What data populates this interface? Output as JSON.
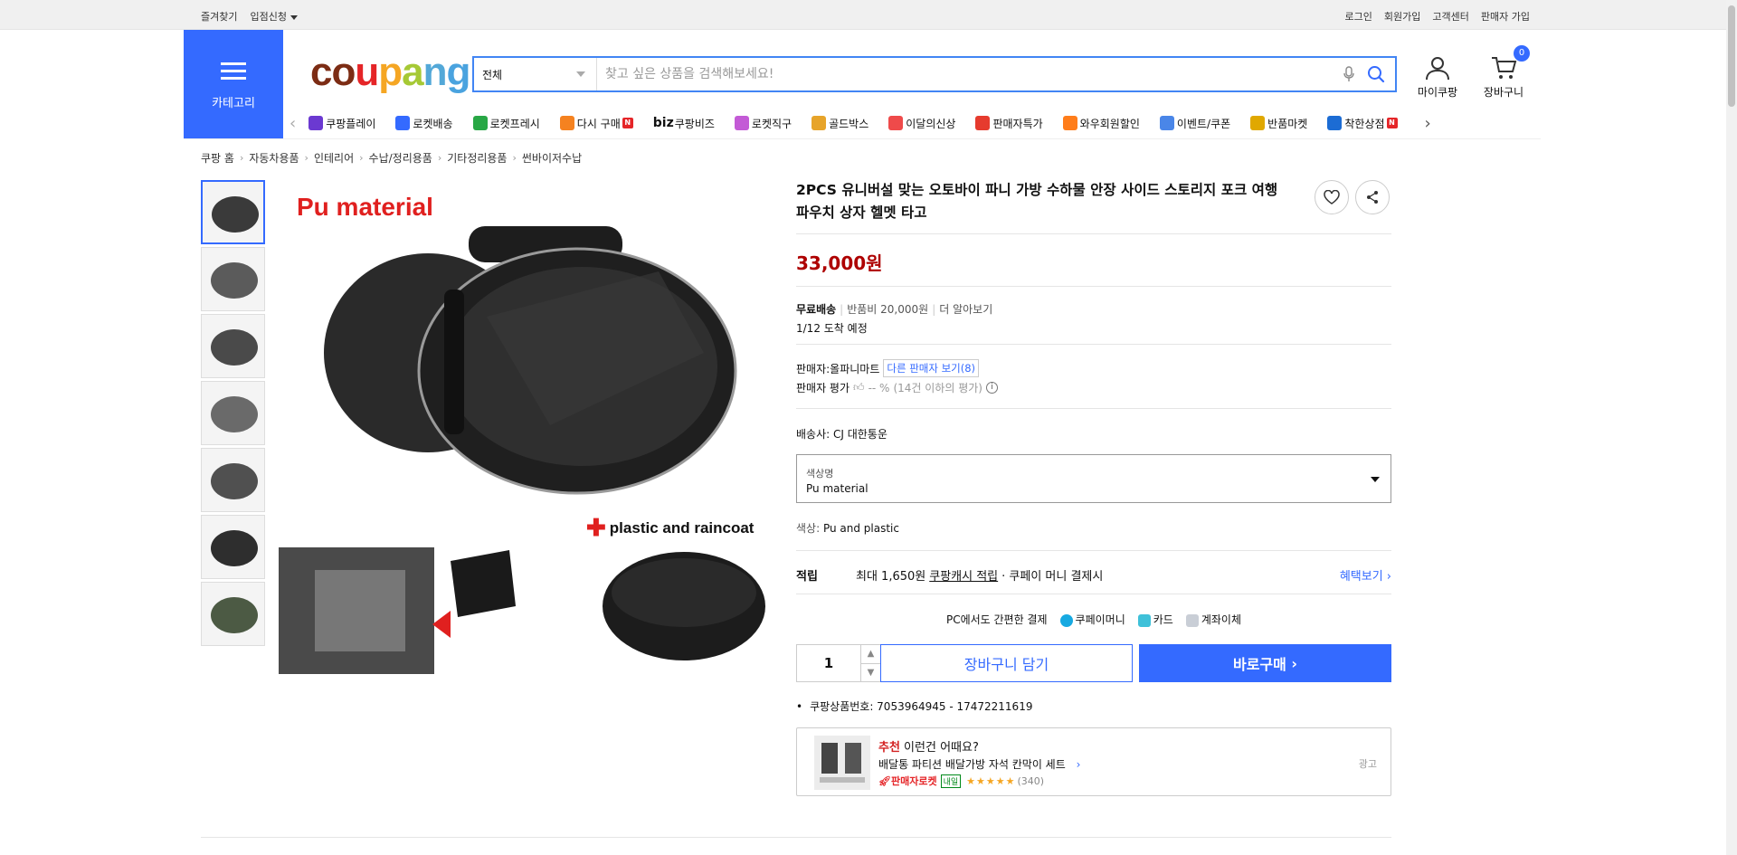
{
  "topbar": {
    "left": [
      "즐겨찾기",
      "입점신청"
    ],
    "right": [
      "로그인",
      "회원가입",
      "고객센터",
      "판매자 가입"
    ]
  },
  "header": {
    "category_label": "카테고리",
    "logo": "coupang",
    "search": {
      "category": "전체",
      "placeholder": "찾고 싶은 상품을 검색해보세요!"
    },
    "mypage_label": "마이쿠팡",
    "cart_label": "장바구니",
    "cart_count": "0"
  },
  "nav": {
    "items": [
      {
        "label": "쿠팡플레이",
        "icon": "play-icon",
        "color": "#6b39d1"
      },
      {
        "label": "로켓배송",
        "icon": "rocket-icon",
        "color": "#346aff"
      },
      {
        "label": "로켓프레시",
        "icon": "rocket-fresh-icon",
        "color": "#28a745"
      },
      {
        "label": "다시 구매",
        "icon": "rebuy-icon",
        "color": "#f58220",
        "badge": "N"
      },
      {
        "label": "쿠팡비즈",
        "prefix": "biz",
        "icon": "biz-icon",
        "color": "#111"
      },
      {
        "label": "로켓직구",
        "icon": "global-icon",
        "color": "#c35ad6"
      },
      {
        "label": "골드박스",
        "icon": "goldbox-icon",
        "color": "#e7a42a"
      },
      {
        "label": "이달의신상",
        "icon": "new-icon",
        "color": "#ef4a4a"
      },
      {
        "label": "판매자특가",
        "icon": "discount-icon",
        "color": "#e63b2e"
      },
      {
        "label": "와우회원할인",
        "icon": "wow-icon",
        "color": "#ff7d1a"
      },
      {
        "label": "이벤트/쿠폰",
        "icon": "coupon-icon",
        "color": "#4a86e8"
      },
      {
        "label": "반품마켓",
        "icon": "market-icon",
        "color": "#e0a800"
      },
      {
        "label": "착한상점",
        "icon": "goodstore-icon",
        "color": "#1c6cd4",
        "badge": "N"
      }
    ]
  },
  "breadcrumb": [
    "쿠팡 홈",
    "자동차용품",
    "인테리어",
    "수납/정리용품",
    "기타정리용품",
    "썬바이저수납"
  ],
  "gallery": {
    "main_text_1": "Pu material",
    "main_text_2": "plastic and raincoat",
    "thumb_count": 7
  },
  "product": {
    "title": "2PCS 유니버설 맞는 오토바이 파니 가방 수하물 안장 사이드 스토리지 포크 여행 파우치 상자 헬멧 타고",
    "price": "33,000원",
    "shipping": {
      "free": "무료배송",
      "return_fee": "반품비 20,000원",
      "more": "더 알아보기"
    },
    "arrival": "1/12 도착 예정",
    "seller": {
      "label": "판매자:",
      "name": "올파니마트",
      "other_sellers": "다른 판매자 보기(8)"
    },
    "seller_rating": {
      "label": "판매자 평가",
      "value": "-- %",
      "note": "(14건 이하의 평가)"
    },
    "courier": "배송사:  CJ 대한통운",
    "option": {
      "label": "색상명",
      "value": "Pu material"
    },
    "color_label": "색상:",
    "color_value": "Pu and plastic",
    "points": {
      "label": "적립",
      "text1": "최대 1,650원",
      "link": "쿠팡캐시 적립",
      "text2": "· 쿠페이 머니 결제시",
      "benefit": "혜택보기"
    },
    "pay": {
      "title": "PC에서도 간편한 결제",
      "methods": [
        "쿠페이머니",
        "카드",
        "계좌이체"
      ]
    },
    "quantity": "1",
    "cart_button": "장바구니 담기",
    "buy_button": "바로구매",
    "product_id": "쿠팡상품번호: 7053964945 - 17472211619"
  },
  "recommend": {
    "highlight": "추천",
    "title": " 이런건 어때요?",
    "name": "배달통 파티션 배달가방 자석 칸막이 세트",
    "badge": "판매자로켓",
    "tag": "내일",
    "stars": "★★★★★",
    "reviews": "(340)",
    "ad": "광고"
  }
}
